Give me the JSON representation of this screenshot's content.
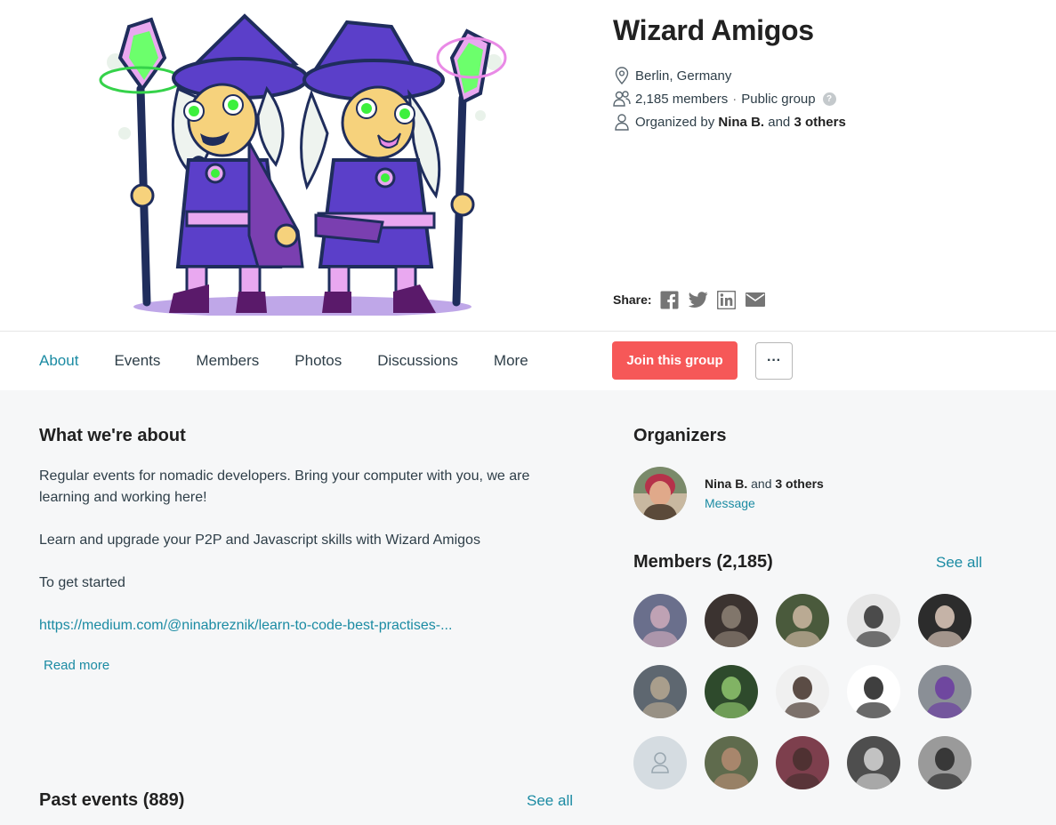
{
  "group": {
    "title": "Wizard Amigos",
    "location": "Berlin, Germany",
    "members_count": "2,185 members",
    "visibility": "Public group",
    "help_glyph": "?",
    "organized_prefix": "Organized by",
    "organizer_name": "Nina B.",
    "organized_and": "and",
    "organizer_others": "3 others"
  },
  "share": {
    "label": "Share:",
    "icons": [
      "facebook-icon",
      "twitter-icon",
      "linkedin-icon",
      "email-icon"
    ]
  },
  "nav": {
    "tabs": [
      {
        "label": "About",
        "active": true
      },
      {
        "label": "Events",
        "active": false
      },
      {
        "label": "Members",
        "active": false
      },
      {
        "label": "Photos",
        "active": false
      },
      {
        "label": "Discussions",
        "active": false
      },
      {
        "label": "More",
        "active": false
      }
    ],
    "join_label": "Join this group",
    "more_options_label": "···"
  },
  "about": {
    "heading": "What we're about",
    "paragraphs": [
      "Regular events for nomadic developers. Bring your computer with you, we are learning and working here!",
      "Learn and upgrade your P2P and Javascript skills with Wizard Amigos",
      "To get started"
    ],
    "link": "https://medium.com/@ninabreznik/learn-to-code-best-practises-...",
    "read_more": "Read more"
  },
  "past_events": {
    "heading": "Past events (889)",
    "see_all": "See all"
  },
  "organizers": {
    "heading": "Organizers",
    "name": "Nina B.",
    "and": "and",
    "others": "3 others",
    "message": "Message"
  },
  "members": {
    "heading": "Members (2,185)",
    "see_all": "See all",
    "avatars": [
      {
        "bg": "#6a6f8c",
        "fg": "#c9a7b8"
      },
      {
        "bg": "#3b3330",
        "fg": "#8a7d72"
      },
      {
        "bg": "#4a5a3c",
        "fg": "#c7b29c"
      },
      {
        "bg": "#e6e6e6",
        "fg": "#3a3a3a"
      },
      {
        "bg": "#2c2c2c",
        "fg": "#d6c2b5"
      },
      {
        "bg": "#5e6770",
        "fg": "#b1a48f"
      },
      {
        "bg": "#2e4a2c",
        "fg": "#8bbf6a"
      },
      {
        "bg": "#f0f0f0",
        "fg": "#4a3a32"
      },
      {
        "bg": "#ffffff",
        "fg": "#2a2a2a"
      },
      {
        "bg": "#8a8f96",
        "fg": "#6b3fa0"
      },
      {
        "bg": "#d5dce1",
        "fg": "#9aa7b0"
      },
      {
        "bg": "#5f6b4d",
        "fg": "#b08a70"
      },
      {
        "bg": "#7d3f4d",
        "fg": "#4a3030"
      },
      {
        "bg": "#4e4e4e",
        "fg": "#cfcfcf"
      },
      {
        "bg": "#9a9a9a",
        "fg": "#2d2d2d"
      }
    ]
  },
  "colors": {
    "accent": "#1b8ba3",
    "join_button": "#f65858",
    "content_bg": "#f6f7f8"
  }
}
